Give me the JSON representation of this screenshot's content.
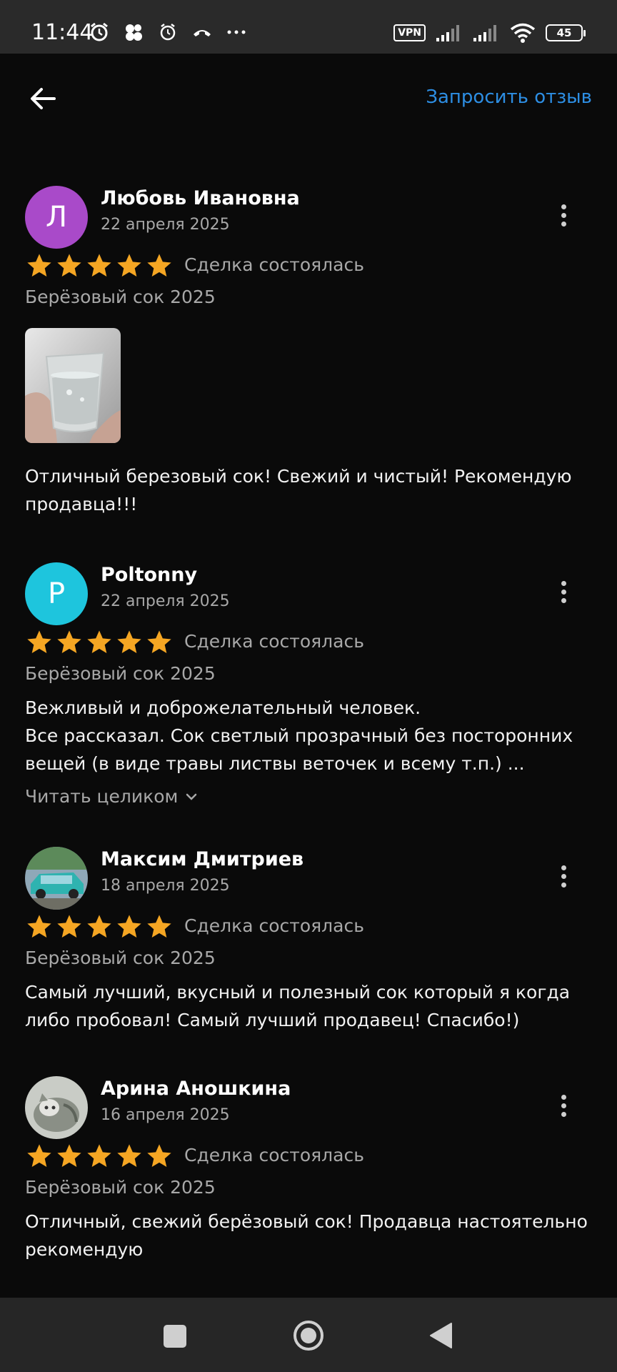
{
  "status_bar": {
    "time": "11:44",
    "vpn": "VPN",
    "battery": "45",
    "icons": [
      "alarm-icon",
      "app-icon",
      "clock-icon",
      "missed-call-icon",
      "more-dots-icon",
      "signal-icon",
      "signal-icon",
      "wifi-icon",
      "battery-icon"
    ]
  },
  "header": {
    "back_icon": "arrow-left-icon",
    "request_review": "Запросить отзыв"
  },
  "reviews": [
    {
      "author": "Любовь Ивановна",
      "initial": "Л",
      "avatar_color": "#a94ac9",
      "date": "22 апреля 2025",
      "rating": 5,
      "status": "Сделка состоялась",
      "product": "Берёзовый сок 2025",
      "text": "Отличный березовый сок! Свежий и чистый! Рекомендую продавца!!!"
    },
    {
      "author": "Poltonny",
      "initial": "P",
      "avatar_color": "#1ec5dd",
      "date": "22 апреля 2025",
      "rating": 5,
      "status": "Сделка состоялась",
      "product": "Берёзовый сок 2025",
      "text": "Вежливый и доброжелательный человек.\nВсе рассказал. Сок  светлый прозрачный без посторонних вещей (в виде травы листвы веточек и всему т.п.) ...",
      "read_more": "Читать целиком"
    },
    {
      "author": "Максим Дмитриев",
      "date": "18 апреля 2025",
      "rating": 5,
      "status": "Сделка состоялась",
      "product": "Берёзовый сок 2025",
      "text": "Самый лучший, вкусный и полезный сок который я когда либо пробовал! Самый лучший продавец! Спасибо!)"
    },
    {
      "author": "Арина Аношкина",
      "date": "16 апреля 2025",
      "rating": 5,
      "status": "Сделка состоялась",
      "product": "Берёзовый сок 2025",
      "text": "Отличный, свежий берёзовый сок! Продавца настоятельно рекомендую"
    }
  ],
  "colors": {
    "background": "#0a0a0a",
    "accent": "#2d8ee3",
    "star": "#f5a623",
    "secondary_text": "#a8a8a8"
  },
  "nav_bar": {
    "icons": [
      "recents-square-icon",
      "home-circle-icon",
      "back-triangle-icon"
    ]
  }
}
